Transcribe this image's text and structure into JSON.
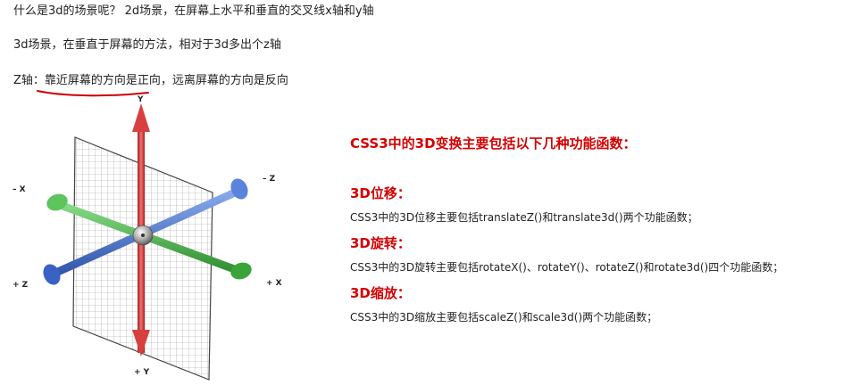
{
  "intro": {
    "line1": "什么是3d的场景呢？ 2d场景，在屏幕上水平和垂直的交叉线x轴和y轴",
    "line2": "3d场景，在垂直于屏幕的方法，相对于3d多出个z轴",
    "line3_prefix": "Z轴：",
    "line3_highlight": "靠近屏幕的方向是正向",
    "line3_suffix": "，远离屏幕的方向是反向"
  },
  "diagram": {
    "labels": {
      "y_top": "Y",
      "y_bottom": "+ Y",
      "x_left": "– X",
      "x_right": "+ X",
      "z_top_right": "– Z",
      "z_bottom_left": "+ Z"
    },
    "colors": {
      "y_axis": "#e05050",
      "x_axis": "#4cbb4c",
      "z_axis": "#4a78d4",
      "grid": "#9a9a9a",
      "underline": "#cc0000"
    }
  },
  "panel": {
    "title": "CSS3中的3D变换主要包括以下几种功能函数：",
    "sections": [
      {
        "heading": "3D位移：",
        "text": "CSS3中的3D位移主要包括translateZ()和translate3d()两个功能函数；"
      },
      {
        "heading": "3D旋转：",
        "text": "CSS3中的3D旋转主要包括rotateX()、rotateY()、rotateZ()和rotate3d()四个功能函数；"
      },
      {
        "heading": "3D缩放：",
        "text": "CSS3中的3D缩放主要包括scaleZ()和scale3d()两个功能函数；"
      }
    ]
  }
}
